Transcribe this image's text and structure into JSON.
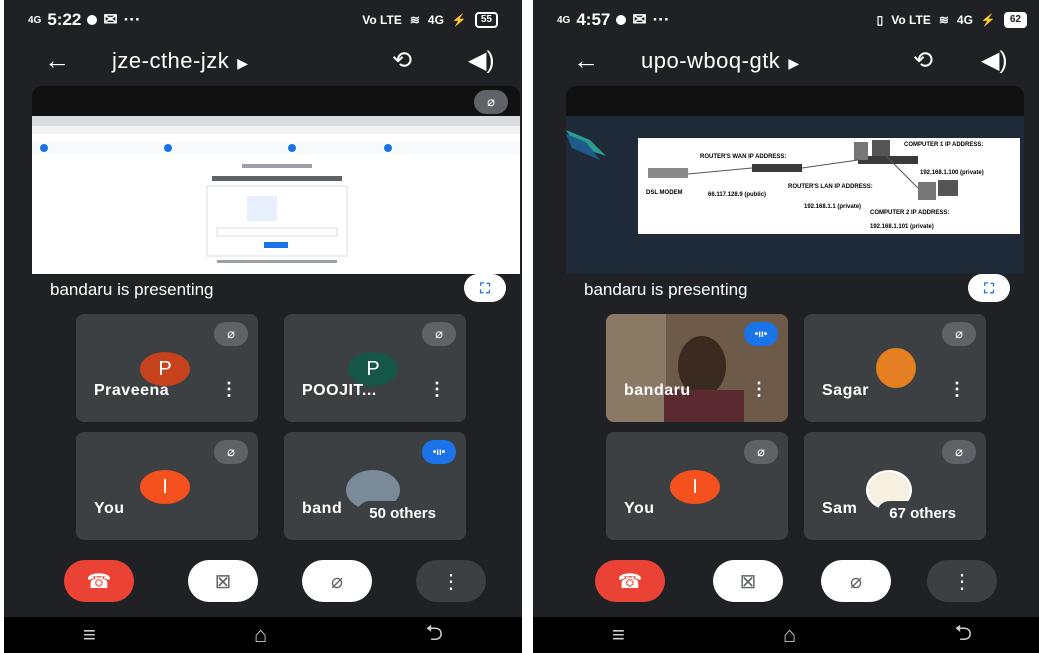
{
  "left": {
    "status": {
      "carrier": "4G",
      "time": "5:22",
      "dots": "···",
      "network": "4G",
      "battery": "55"
    },
    "header": {
      "meeting_code": "jze-cthe-jzk"
    },
    "presenting": "bandaru is presenting",
    "tiles": [
      {
        "name": "Praveena",
        "initial": "P",
        "color": "#c5421c"
      },
      {
        "name": "POOJIT...",
        "initial": "P",
        "color": "#17574a"
      },
      {
        "name": "You",
        "initial": "I",
        "color": "#f4511e"
      },
      {
        "name": "band",
        "others": "50 others"
      }
    ]
  },
  "right": {
    "status": {
      "carrier": "4G",
      "time": "4:57",
      "dots": "···",
      "network": "4G",
      "battery": "62"
    },
    "header": {
      "meeting_code": "upo-wboq-gtk"
    },
    "presenting": "bandaru is presenting",
    "tiles": [
      {
        "name": "bandaru"
      },
      {
        "name": "Sagar"
      },
      {
        "name": "You",
        "initial": "I",
        "color": "#f4511e"
      },
      {
        "name": "Sam",
        "others": "67 others"
      }
    ],
    "diagram": {
      "modem": "DSL MODEM",
      "wan": "ROUTER'S WAN IP ADDRESS:",
      "wan_ip": "66.117.128.9 (public)",
      "lan": "ROUTER'S LAN IP ADDRESS:",
      "lan_ip": "192.168.1.1 (private)",
      "c1": "COMPUTER 1 IP ADDRESS:",
      "c1_ip": "192.168.1.100 (private)",
      "c2": "COMPUTER 2 IP ADDRESS:",
      "c2_ip": "192.168.1.101 (private)"
    }
  },
  "icons": [
    "back-arrow-icon",
    "switch-camera-icon",
    "speaker-icon",
    "mic-off-icon",
    "fullscreen-icon",
    "more-vert-icon",
    "end-call-icon",
    "video-off-icon",
    "menu-icon",
    "home-icon",
    "back-icon",
    "speaking-icon"
  ]
}
